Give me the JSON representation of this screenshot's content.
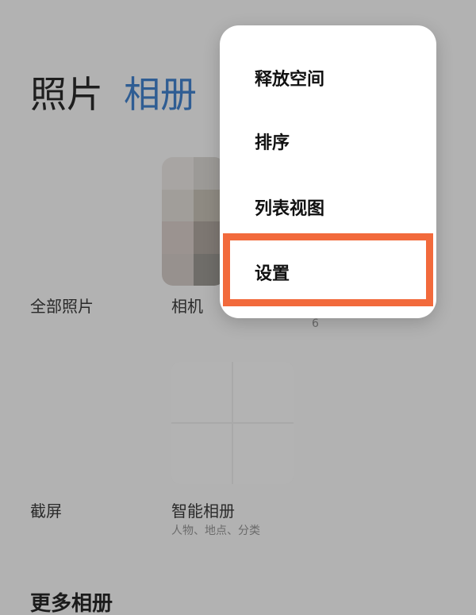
{
  "tabs": {
    "photos": "照片",
    "albums": "相册"
  },
  "albums": [
    {
      "name": "全部照片"
    },
    {
      "name": "相机"
    },
    {
      "name": "",
      "count": "6"
    },
    {
      "name": "截屏"
    },
    {
      "name": "智能相册",
      "subtitle": "人物、地点、分类"
    }
  ],
  "section": {
    "more_albums": "更多相册"
  },
  "menu": {
    "items": [
      "释放空间",
      "排序",
      "列表视图",
      "设置"
    ],
    "highlighted": "设置"
  },
  "colors": {
    "accent": "#2f5d93",
    "highlight": "#f26a3c",
    "overlay_bg": "#b2b2b2",
    "menu_bg": "#ffffff"
  }
}
